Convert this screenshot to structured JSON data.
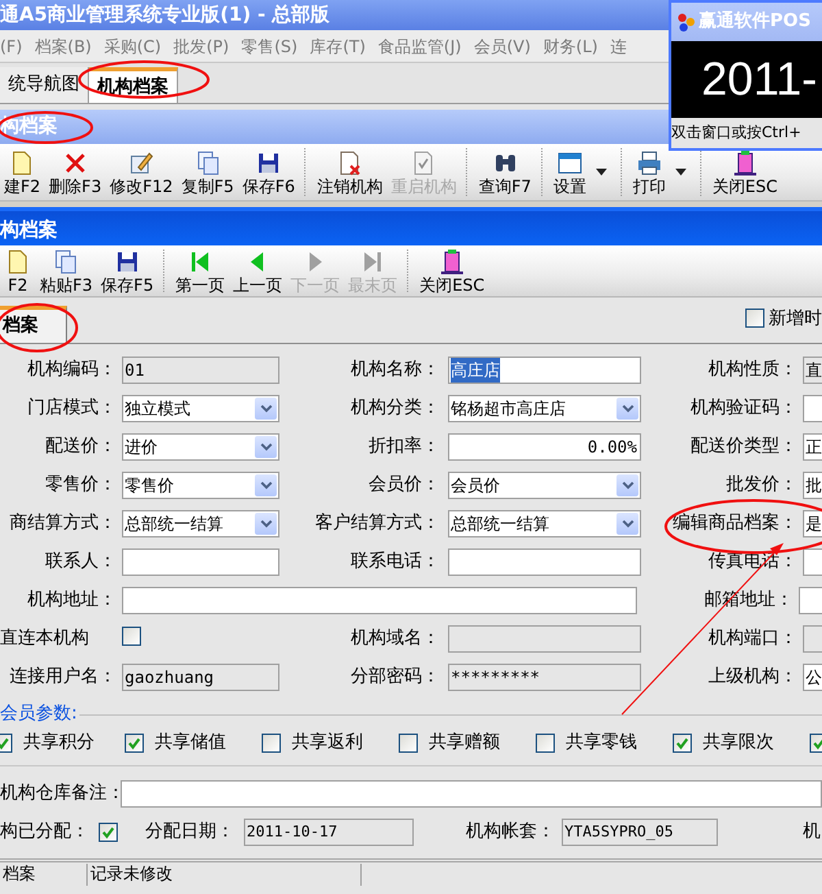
{
  "window": {
    "title": "通A5商业管理系统专业版(1) - 总部版"
  },
  "menu": [
    "(F)",
    "档案(B)",
    "采购(C)",
    "批发(P)",
    "零售(S)",
    "库存(T)",
    "食品监管(J)",
    "会员(V)",
    "财务(L)",
    "连"
  ],
  "doc_tabs": [
    {
      "label": "统导航图",
      "selected": false
    },
    {
      "label": "机构档案",
      "selected": true
    }
  ],
  "list_panel": {
    "title": "构档案",
    "toolbar": [
      {
        "label": "建F2",
        "disabled": false,
        "separator_before": false,
        "dropdown": false
      },
      {
        "label": "删除F3",
        "disabled": false,
        "separator_before": false,
        "dropdown": false
      },
      {
        "label": "修改F12",
        "disabled": false,
        "separator_before": false,
        "dropdown": false
      },
      {
        "label": "复制F5",
        "disabled": false,
        "separator_before": false,
        "dropdown": false
      },
      {
        "label": "保存F6",
        "disabled": false,
        "separator_before": false,
        "dropdown": false
      },
      {
        "label": "注销机构",
        "disabled": false,
        "separator_before": true,
        "dropdown": false
      },
      {
        "label": "重启机构",
        "disabled": true,
        "separator_before": false,
        "dropdown": false
      },
      {
        "label": "查询F7",
        "disabled": false,
        "separator_before": true,
        "dropdown": false
      },
      {
        "label": "设置",
        "disabled": false,
        "separator_before": true,
        "dropdown": true
      },
      {
        "label": "打印",
        "disabled": false,
        "separator_before": true,
        "dropdown": true
      },
      {
        "label": "关闭ESC",
        "disabled": false,
        "separator_before": true,
        "dropdown": false
      }
    ]
  },
  "popup": {
    "title": "赢通软件POS",
    "clock": "2011-",
    "hint": "双击窗口或按Ctrl+"
  },
  "editor": {
    "title": "构档案",
    "toolbar": [
      {
        "label": "F2",
        "disabled": false,
        "separator_before": false,
        "dropdown": false
      },
      {
        "label": "粘贴F3",
        "disabled": false,
        "separator_before": false,
        "dropdown": false
      },
      {
        "label": "保存F5",
        "disabled": false,
        "separator_before": false,
        "dropdown": false
      },
      {
        "label": "第一页",
        "disabled": false,
        "separator_before": true,
        "dropdown": false
      },
      {
        "label": "上一页",
        "disabled": false,
        "separator_before": false,
        "dropdown": false
      },
      {
        "label": "下一页",
        "disabled": true,
        "separator_before": false,
        "dropdown": false
      },
      {
        "label": "最末页",
        "disabled": true,
        "separator_before": false,
        "dropdown": false
      },
      {
        "label": "关闭ESC",
        "disabled": false,
        "separator_before": true,
        "dropdown": false
      }
    ],
    "tabs": [
      {
        "label": "档案",
        "selected": true
      }
    ],
    "new_option": {
      "label": "新增时",
      "checked": false
    },
    "rows": [
      [
        {
          "label": "机构编码：",
          "kind": "readonly",
          "value": "01"
        },
        {
          "label": "机构名称：",
          "kind": "text",
          "value": "高庄店",
          "highlight": true
        },
        {
          "label": "机构性质：",
          "kind": "readonly",
          "value": "直"
        }
      ],
      [
        {
          "label": "门店模式：",
          "kind": "select",
          "value": "独立模式"
        },
        {
          "label": "机构分类：",
          "kind": "select",
          "value": "铭杨超市高庄店"
        },
        {
          "label": "机构验证码：",
          "kind": "text"
        }
      ],
      [
        {
          "label": "配送价：",
          "kind": "select",
          "value": "进价"
        },
        {
          "label": "折扣率：",
          "kind": "number",
          "value": "0.00%"
        },
        {
          "label": "配送价类型：",
          "kind": "text",
          "value": "正"
        }
      ],
      [
        {
          "label": "零售价：",
          "kind": "select",
          "value": "零售价"
        },
        {
          "label": "会员价：",
          "kind": "select",
          "value": "会员价"
        },
        {
          "label": "批发价：",
          "kind": "text",
          "value": "批"
        }
      ],
      [
        {
          "label": "商结算方式：",
          "kind": "select",
          "value": "总部统一结算"
        },
        {
          "label": "客户结算方式：",
          "kind": "select",
          "value": "总部统一结算"
        },
        {
          "label": "编辑商品档案：",
          "kind": "text",
          "value": "是"
        }
      ],
      [
        {
          "label": "联系人：",
          "kind": "text"
        },
        {
          "label": "联系电话：",
          "kind": "text"
        },
        {
          "label": "传真电话：",
          "kind": "text"
        }
      ],
      [
        {
          "label": "机构地址：",
          "kind": "wide"
        },
        {
          "kind": "blank"
        },
        {
          "label": "邮箱地址：",
          "kind": "text"
        }
      ],
      [
        {
          "label": "直连本机构",
          "kind": "check",
          "checked": false
        },
        {
          "label": "机构域名：",
          "kind": "readonly"
        },
        {
          "label": "机构端口：",
          "kind": "readonly"
        }
      ],
      [
        {
          "label": "连接用户名：",
          "kind": "readonly",
          "value": "gaozhuang"
        },
        {
          "label": "分部密码：",
          "kind": "readonly",
          "value": "*********"
        },
        {
          "label": "上级机构：",
          "kind": "text",
          "value": "公"
        }
      ]
    ],
    "member_group": {
      "title": "会员参数:",
      "options": [
        {
          "label": "共享积分",
          "checked": true
        },
        {
          "label": "共享储值",
          "checked": true
        },
        {
          "label": "共享返利",
          "checked": false
        },
        {
          "label": "共享赠额",
          "checked": false
        },
        {
          "label": "共享零钱",
          "checked": false
        },
        {
          "label": "共享限次",
          "checked": true
        },
        {
          "checked": true
        }
      ]
    },
    "remark": {
      "label": "机构仓库备注："
    },
    "assigned": {
      "label": "构已分配：",
      "checked": true
    },
    "assign_date": {
      "label": "分配日期：",
      "value": "2011-10-17"
    },
    "account": {
      "label": "机构帐套：",
      "value": "YTA5SYPRO_05"
    },
    "cut_label": "机"
  },
  "status_bar": [
    "档案",
    "记录未修改"
  ]
}
